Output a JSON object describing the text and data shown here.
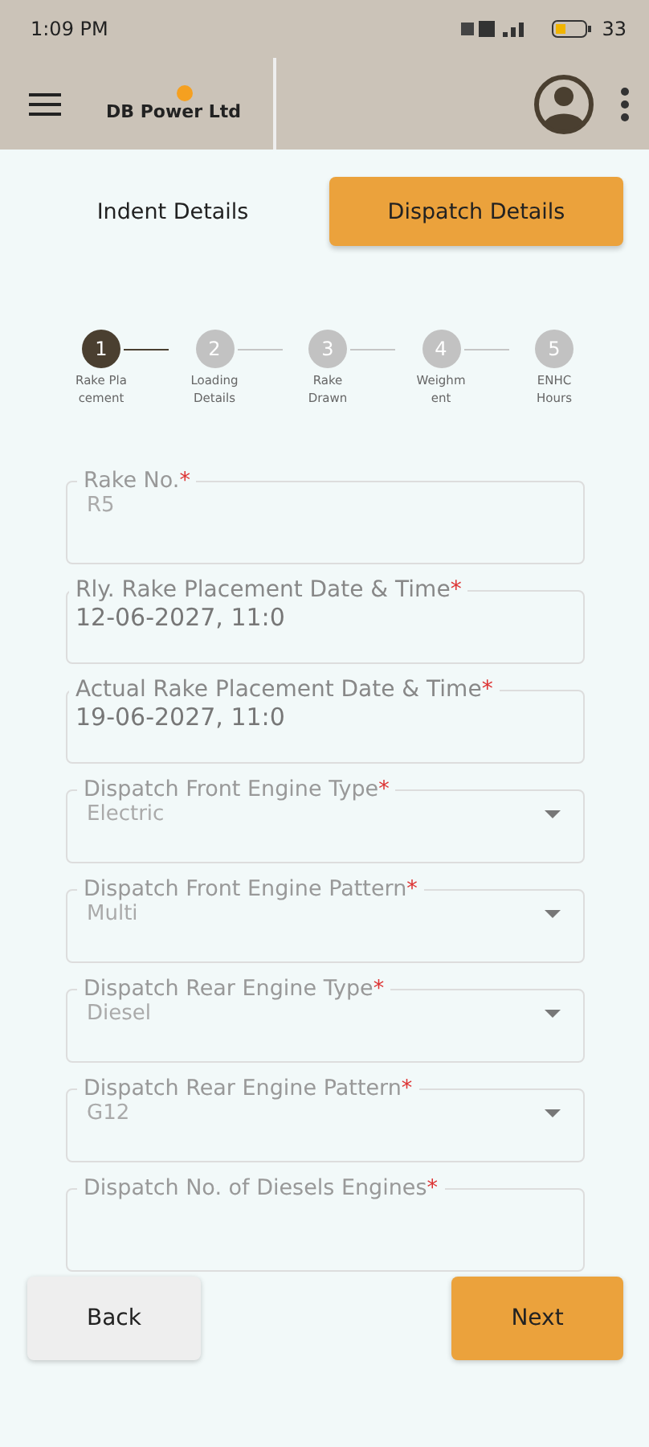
{
  "status_bar": {
    "time": "1:09 PM",
    "battery": "33"
  },
  "header": {
    "brand": "DB Power Ltd"
  },
  "tabs": [
    {
      "label": "Indent Details",
      "selected": false
    },
    {
      "label": "Dispatch Details",
      "selected": true
    }
  ],
  "steps": [
    {
      "number": "1",
      "label_lines": [
        "Rake Pla",
        "cement"
      ],
      "selected": true
    },
    {
      "number": "2",
      "label_lines": [
        "Loading",
        "Details"
      ],
      "selected": false
    },
    {
      "number": "3",
      "label_lines": [
        "Rake",
        "Drawn"
      ],
      "selected": false
    },
    {
      "number": "4",
      "label_lines": [
        "Weighm",
        "ent"
      ],
      "selected": false
    },
    {
      "number": "5",
      "label_lines": [
        "ENHC",
        "Hours"
      ],
      "selected": false
    }
  ],
  "fields": [
    {
      "kind": "text",
      "label": "Rake No.",
      "required_mark": "*",
      "value": "R5"
    },
    {
      "kind": "date",
      "label": "Rly. Rake Placement Date & Time",
      "required_mark": "*",
      "value": "12-06-2027, 11:0"
    },
    {
      "kind": "date",
      "label": "Actual Rake Placement Date & Time",
      "required_mark": "*",
      "value": "19-06-2027, 11:0"
    },
    {
      "kind": "select",
      "label": "Dispatch Front Engine Type",
      "required_mark": "*",
      "value": "Electric"
    },
    {
      "kind": "select",
      "label": "Dispatch Front Engine Pattern",
      "required_mark": "*",
      "value": "Multi"
    },
    {
      "kind": "select",
      "label": "Dispatch Rear Engine Type",
      "required_mark": "*",
      "value": "Diesel"
    },
    {
      "kind": "select",
      "label": "Dispatch Rear Engine Pattern",
      "required_mark": "*",
      "value": "G12"
    },
    {
      "kind": "text",
      "label": "Dispatch No. of Diesels Engines",
      "required_mark": "*"
    }
  ],
  "buttons": {
    "back": "Back",
    "next": "Next"
  }
}
